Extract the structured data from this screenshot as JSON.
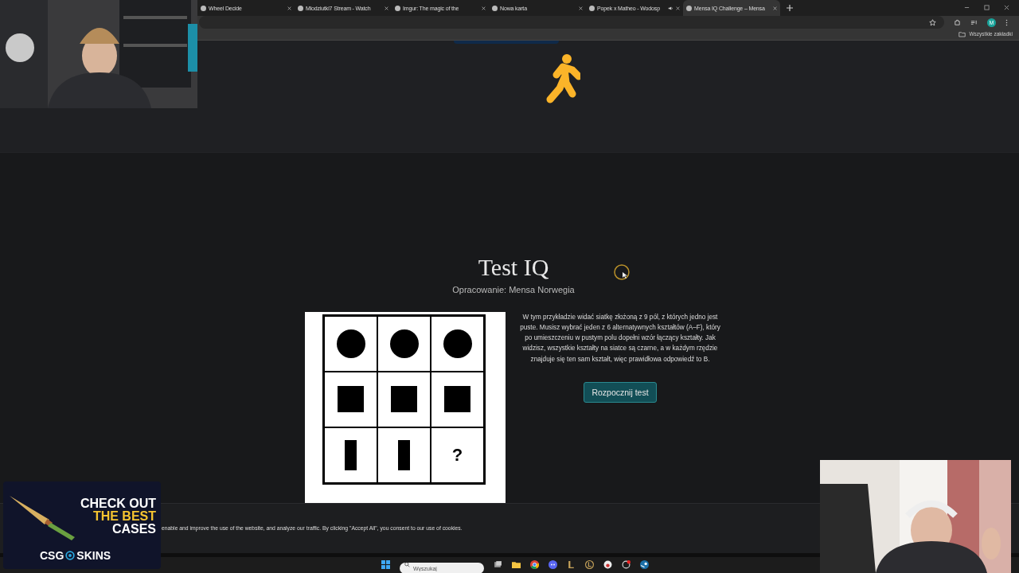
{
  "browser": {
    "tabs": [
      {
        "label": "Wheel Decide",
        "selected": false,
        "audio": false
      },
      {
        "label": "Mlodziutki7 Stream - Watch",
        "selected": false,
        "audio": false
      },
      {
        "label": "Imgur: The magic of the",
        "selected": false,
        "audio": false
      },
      {
        "label": "Nowa karta",
        "selected": false,
        "audio": false
      },
      {
        "label": "Popek x Matheo - Wodosp",
        "selected": false,
        "audio": true
      },
      {
        "label": "Mensa IQ Challenge – Mensa",
        "selected": true,
        "audio": false
      }
    ],
    "profile_initial": "M",
    "bookmarks_folder": "Wszystkie zakładki"
  },
  "page": {
    "title": "Test IQ",
    "subtitle": "Opracowanie: Mensa Norwegia",
    "example_grid": [
      {
        "kind": "circle"
      },
      {
        "kind": "circle"
      },
      {
        "kind": "circle"
      },
      {
        "kind": "square"
      },
      {
        "kind": "square"
      },
      {
        "kind": "square"
      },
      {
        "kind": "bar"
      },
      {
        "kind": "bar"
      },
      {
        "kind": "question",
        "text": "?"
      }
    ],
    "description": "W tym przykładzie widać siatkę złożoną z 9 pól, z których jedno jest puste. Musisz wybrać jeden z 6 alternatywnych kształtów (A–F), który po umieszczeniu w pustym polu dopełni wzór łączący kształty. Jak widzisz, wszystkie kształty na siatce są czarne, a w każdym rzędzie znajduje się ten sam kształt, więc prawidłowa odpowiedź to B.",
    "start_button": "Rozpocznij test"
  },
  "cookie_notice": "enable and improve the use of the website, and analyze our traffic. By clicking \"Accept All\", you consent to our use of cookies.",
  "ad_overlay": {
    "headline_1": "CHECK OUT",
    "headline_2": "THE BEST",
    "headline_3": "CASES",
    "brand_1": "CSG",
    "brand_2": "SKINS"
  },
  "taskbar": {
    "search_placeholder": "Wyszukaj"
  }
}
